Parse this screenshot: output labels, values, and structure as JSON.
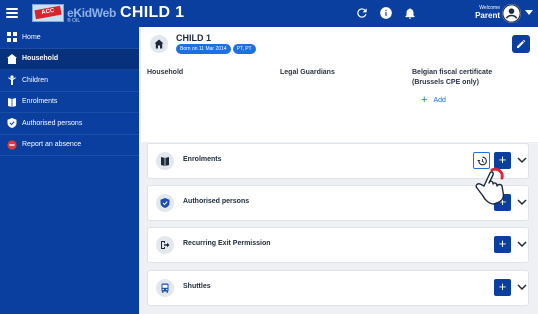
{
  "header": {
    "logo_text": "eKidWeb",
    "logo_ribbon": "ACC",
    "logo_sub": "® OIL",
    "title": "CHILD 1",
    "welcome": "Welcome",
    "user": "Parent",
    "icons": [
      "menu-icon",
      "refresh-icon",
      "info-icon",
      "bell-icon",
      "account-circle-icon",
      "chevron-down-icon"
    ]
  },
  "sidebar": {
    "items": [
      {
        "label": "Home",
        "icon": "home-icon",
        "active": false
      },
      {
        "label": "Household",
        "icon": "household-icon",
        "active": true
      },
      {
        "label": "Children",
        "icon": "child-icon",
        "active": false
      },
      {
        "label": "Enrolments",
        "icon": "enrolment-icon",
        "active": false
      },
      {
        "label": "Authorised persons",
        "icon": "shield-icon",
        "active": false
      },
      {
        "label": "Report an absence",
        "icon": "absence-icon",
        "active": false
      }
    ]
  },
  "child": {
    "name": "CHILD 1",
    "born": "Born on 11 Mar 2014",
    "lang": "PT, PT"
  },
  "household": {
    "col1": "Household",
    "col2": "Legal Guardians",
    "col3_line1": "Belgian fiscal certificate",
    "col3_line2": "(Brussels CPE only)",
    "add_label": "Add"
  },
  "sections": [
    {
      "label": "Enrolments",
      "icon": "enrolment-icon"
    },
    {
      "label": "Authorised persons",
      "icon": "shield-icon"
    },
    {
      "label": "Recurring Exit Permission",
      "icon": "exit-icon"
    },
    {
      "label": "Shuttles",
      "icon": "bus-icon"
    }
  ],
  "colors": {
    "primary": "#0a3fa0",
    "accent": "#1e6fe0",
    "cursor_ring": "#e0243a"
  }
}
